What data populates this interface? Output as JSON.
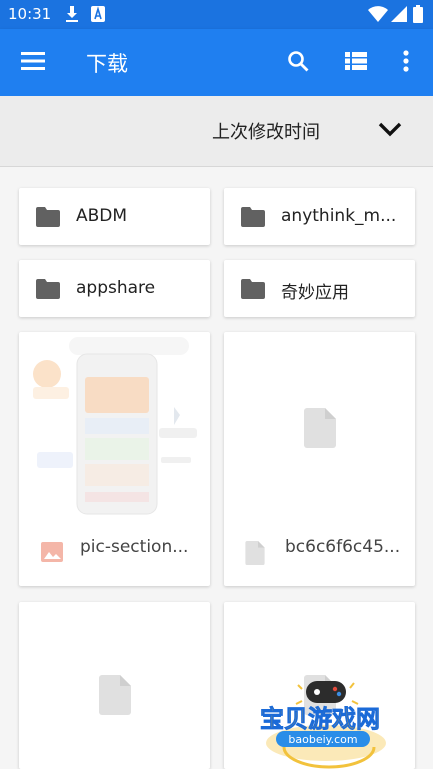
{
  "status_bar": {
    "time": "10:31"
  },
  "app_bar": {
    "title": "下载",
    "icons": [
      "menu-icon",
      "search-icon",
      "list-view-icon",
      "more-vert-icon"
    ]
  },
  "sort": {
    "label": "上次修改时间"
  },
  "folders": [
    {
      "name": "ABDM"
    },
    {
      "name": "anythink_m..."
    },
    {
      "name": "appshare"
    },
    {
      "name": "奇妙应用"
    }
  ],
  "files": [
    {
      "name": "pic-section...",
      "type": "image"
    },
    {
      "name": "bc6c6f6c45...",
      "type": "file"
    },
    {
      "name": "",
      "type": "file"
    },
    {
      "name": "",
      "type": "file"
    }
  ],
  "watermark": {
    "title": "宝贝游戏网",
    "url": "baobeiy.com"
  },
  "colors": {
    "status": "#1b73e0",
    "appbar": "#1f7ff0",
    "folder_icon": "#616161",
    "file_icon": "#e0e0e0",
    "image_icon": "#f4b6a8"
  }
}
